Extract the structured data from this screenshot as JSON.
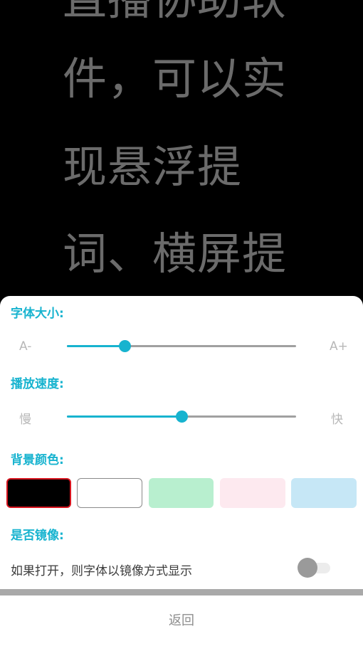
{
  "prompter": {
    "lines": [
      "直播协助软",
      "件，可以实",
      "现悬浮提",
      "词、横屏提"
    ],
    "text_color": "#6b6b6b",
    "background": "#000000"
  },
  "settings": {
    "font_size": {
      "title": "字体大小:",
      "min_label": "A-",
      "max_label": "A+",
      "value_fraction": 0.25
    },
    "speed": {
      "title": "播放速度:",
      "min_label": "慢",
      "max_label": "快",
      "value_fraction": 0.5
    },
    "background_color": {
      "title": "背景颜色:",
      "options": [
        {
          "color": "#000000",
          "selected": true
        },
        {
          "color": "#ffffff",
          "selected": false
        },
        {
          "color": "#b8efcf",
          "selected": false
        },
        {
          "color": "#fde9ef",
          "selected": false
        },
        {
          "color": "#c6e7f6",
          "selected": false
        }
      ],
      "selected_border": "#d8141e"
    },
    "mirror": {
      "title": "是否镜像:",
      "description": "如果打开，则字体以镜像方式显示",
      "enabled": false
    }
  },
  "footer": {
    "back_label": "返回"
  },
  "colors": {
    "accent": "#17b3cf",
    "track": "#a0a0a0"
  }
}
